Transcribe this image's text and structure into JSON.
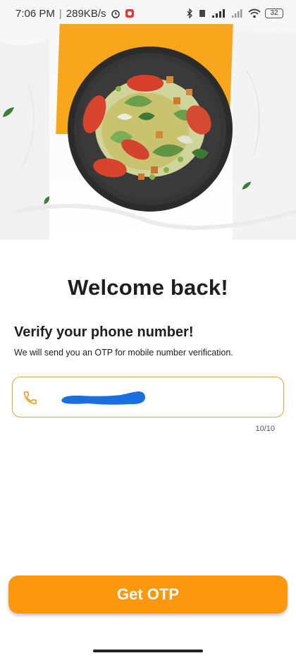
{
  "status_bar": {
    "time": "7:06 PM",
    "separator": "|",
    "speed": "289KB/s",
    "battery": "32"
  },
  "hero": {
    "image": "salad-plate",
    "accent_color": "#f8a61b"
  },
  "welcome_title": "Welcome back!",
  "verify": {
    "title": "Verify your phone number!",
    "subtitle": "We will send you an OTP for mobile number verification."
  },
  "phone_field": {
    "icon": "phone-icon",
    "value": "",
    "counter": "10/10",
    "border_color": "#e3a52a"
  },
  "otp_button": {
    "label": "Get OTP",
    "color": "#fb980d"
  }
}
